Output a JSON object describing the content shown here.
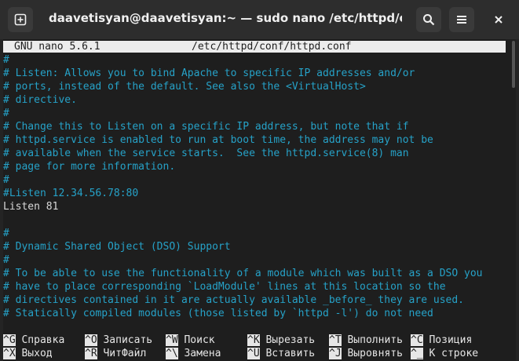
{
  "window": {
    "title": "daavetisyan@daavetisyan:~ — sudo nano /etc/httpd/conf/http…"
  },
  "nano": {
    "version": "GNU nano 5.6.1",
    "filename": "/etc/httpd/conf/httpd.conf"
  },
  "file_lines": [
    {
      "text": "#",
      "type": "comment"
    },
    {
      "text": "# Listen: Allows you to bind Apache to specific IP addresses and/or",
      "type": "comment"
    },
    {
      "text": "# ports, instead of the default. See also the <VirtualHost>",
      "type": "comment"
    },
    {
      "text": "# directive.",
      "type": "comment"
    },
    {
      "text": "#",
      "type": "comment"
    },
    {
      "text": "# Change this to Listen on a specific IP address, but note that if",
      "type": "comment"
    },
    {
      "text": "# httpd.service is enabled to run at boot time, the address may not be",
      "type": "comment"
    },
    {
      "text": "# available when the service starts.  See the httpd.service(8) man",
      "type": "comment"
    },
    {
      "text": "# page for more information.",
      "type": "comment"
    },
    {
      "text": "#",
      "type": "comment"
    },
    {
      "text": "#Listen 12.34.56.78:80",
      "type": "comment"
    },
    {
      "text": "Listen 81",
      "type": "normal"
    },
    {
      "text": "",
      "type": "normal"
    },
    {
      "text": "#",
      "type": "comment"
    },
    {
      "text": "# Dynamic Shared Object (DSO) Support",
      "type": "comment"
    },
    {
      "text": "#",
      "type": "comment"
    },
    {
      "text": "# To be able to use the functionality of a module which was built as a DSO you",
      "type": "comment"
    },
    {
      "text": "# have to place corresponding `LoadModule' lines at this location so the",
      "type": "comment"
    },
    {
      "text": "# directives contained in it are actually available _before_ they are used.",
      "type": "comment"
    },
    {
      "text": "# Statically compiled modules (those listed by `httpd -l') do not need",
      "type": "comment"
    }
  ],
  "shortcuts": [
    [
      {
        "key": "^G",
        "label": "Справка"
      },
      {
        "key": "^O",
        "label": "Записать"
      },
      {
        "key": "^W",
        "label": "Поиск"
      },
      {
        "key": "^K",
        "label": "Вырезать"
      },
      {
        "key": "^T",
        "label": "Выполнить"
      },
      {
        "key": "^C",
        "label": "Позиция"
      }
    ],
    [
      {
        "key": "^X",
        "label": "Выход"
      },
      {
        "key": "^R",
        "label": "ЧитФайл"
      },
      {
        "key": "^\\",
        "label": "Замена"
      },
      {
        "key": "^U",
        "label": "Вставить"
      },
      {
        "key": "^J",
        "label": "Выровнять"
      },
      {
        "key": "^_",
        "label": "К строке"
      }
    ]
  ],
  "icons": {
    "new_tab": "new-tab-icon",
    "search": "search-icon",
    "menu": "hamburger-menu-icon",
    "close": "close-icon"
  }
}
